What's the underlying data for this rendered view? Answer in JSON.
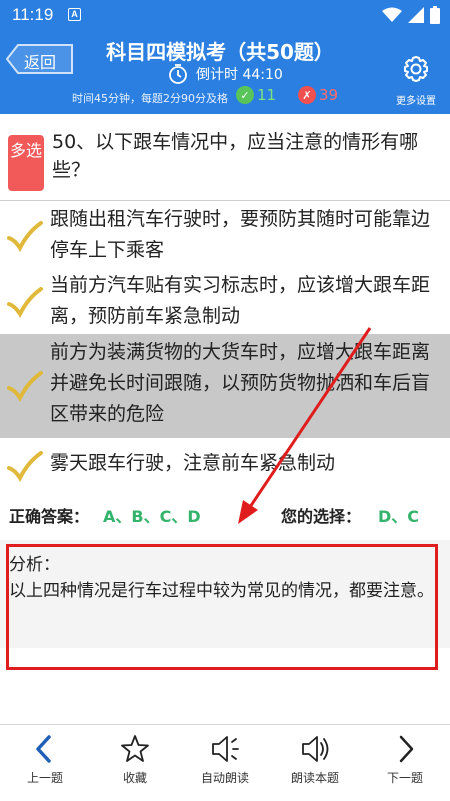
{
  "status_bar": {
    "time": "11:19",
    "notif_letter": "A"
  },
  "header": {
    "back_label": "返回",
    "title": "科目四模拟考（共50题）",
    "countdown": "倒计时 44:10",
    "rule": "时间45分钟，每题2分90分及格",
    "correct_count": "11",
    "wrong_count": "39",
    "settings_label": "更多设置"
  },
  "question": {
    "type_label": "多选",
    "text": "50、以下跟车情况中，应当注意的情形有哪些？"
  },
  "options": [
    {
      "text": "跟随出租汽车行驶时，要预防其随时可能靠边停车上下乘客",
      "selected": false
    },
    {
      "text": "当前方汽车贴有实习标志时，应该增大跟车距离，预防前车紧急制动",
      "selected": false
    },
    {
      "text": "前方为装满货物的大货车时，应增大跟车距离并避免长时间跟随，以预防货物抛洒和车后盲区带来的危险",
      "selected": true
    },
    {
      "text": "雾天跟车行驶，注意前车紧急制动",
      "selected": false
    }
  ],
  "answers": {
    "correct_label": "正确答案：",
    "correct_value": "A、B、C、D",
    "choice_label": "您的选择：",
    "choice_value": "D、C"
  },
  "analysis": {
    "heading": "分析：",
    "body": "以上四种情况是行车过程中较为常见的情况，都要注意。"
  },
  "bottom_nav": [
    {
      "label": "上一题",
      "icon": "chevron-left-icon"
    },
    {
      "label": "收藏",
      "icon": "star-icon"
    },
    {
      "label": "自动朗读",
      "icon": "speaker-icon"
    },
    {
      "label": "朗读本题",
      "icon": "speaker-wave-icon"
    },
    {
      "label": "下一题",
      "icon": "chevron-right-icon"
    }
  ],
  "colors": {
    "header_blue": "#2a7fe0",
    "correct_green": "#33b36b",
    "wrong_red": "#f25a5a",
    "check_gold": "#e0b93a",
    "annotation_red": "#e01d1d"
  }
}
